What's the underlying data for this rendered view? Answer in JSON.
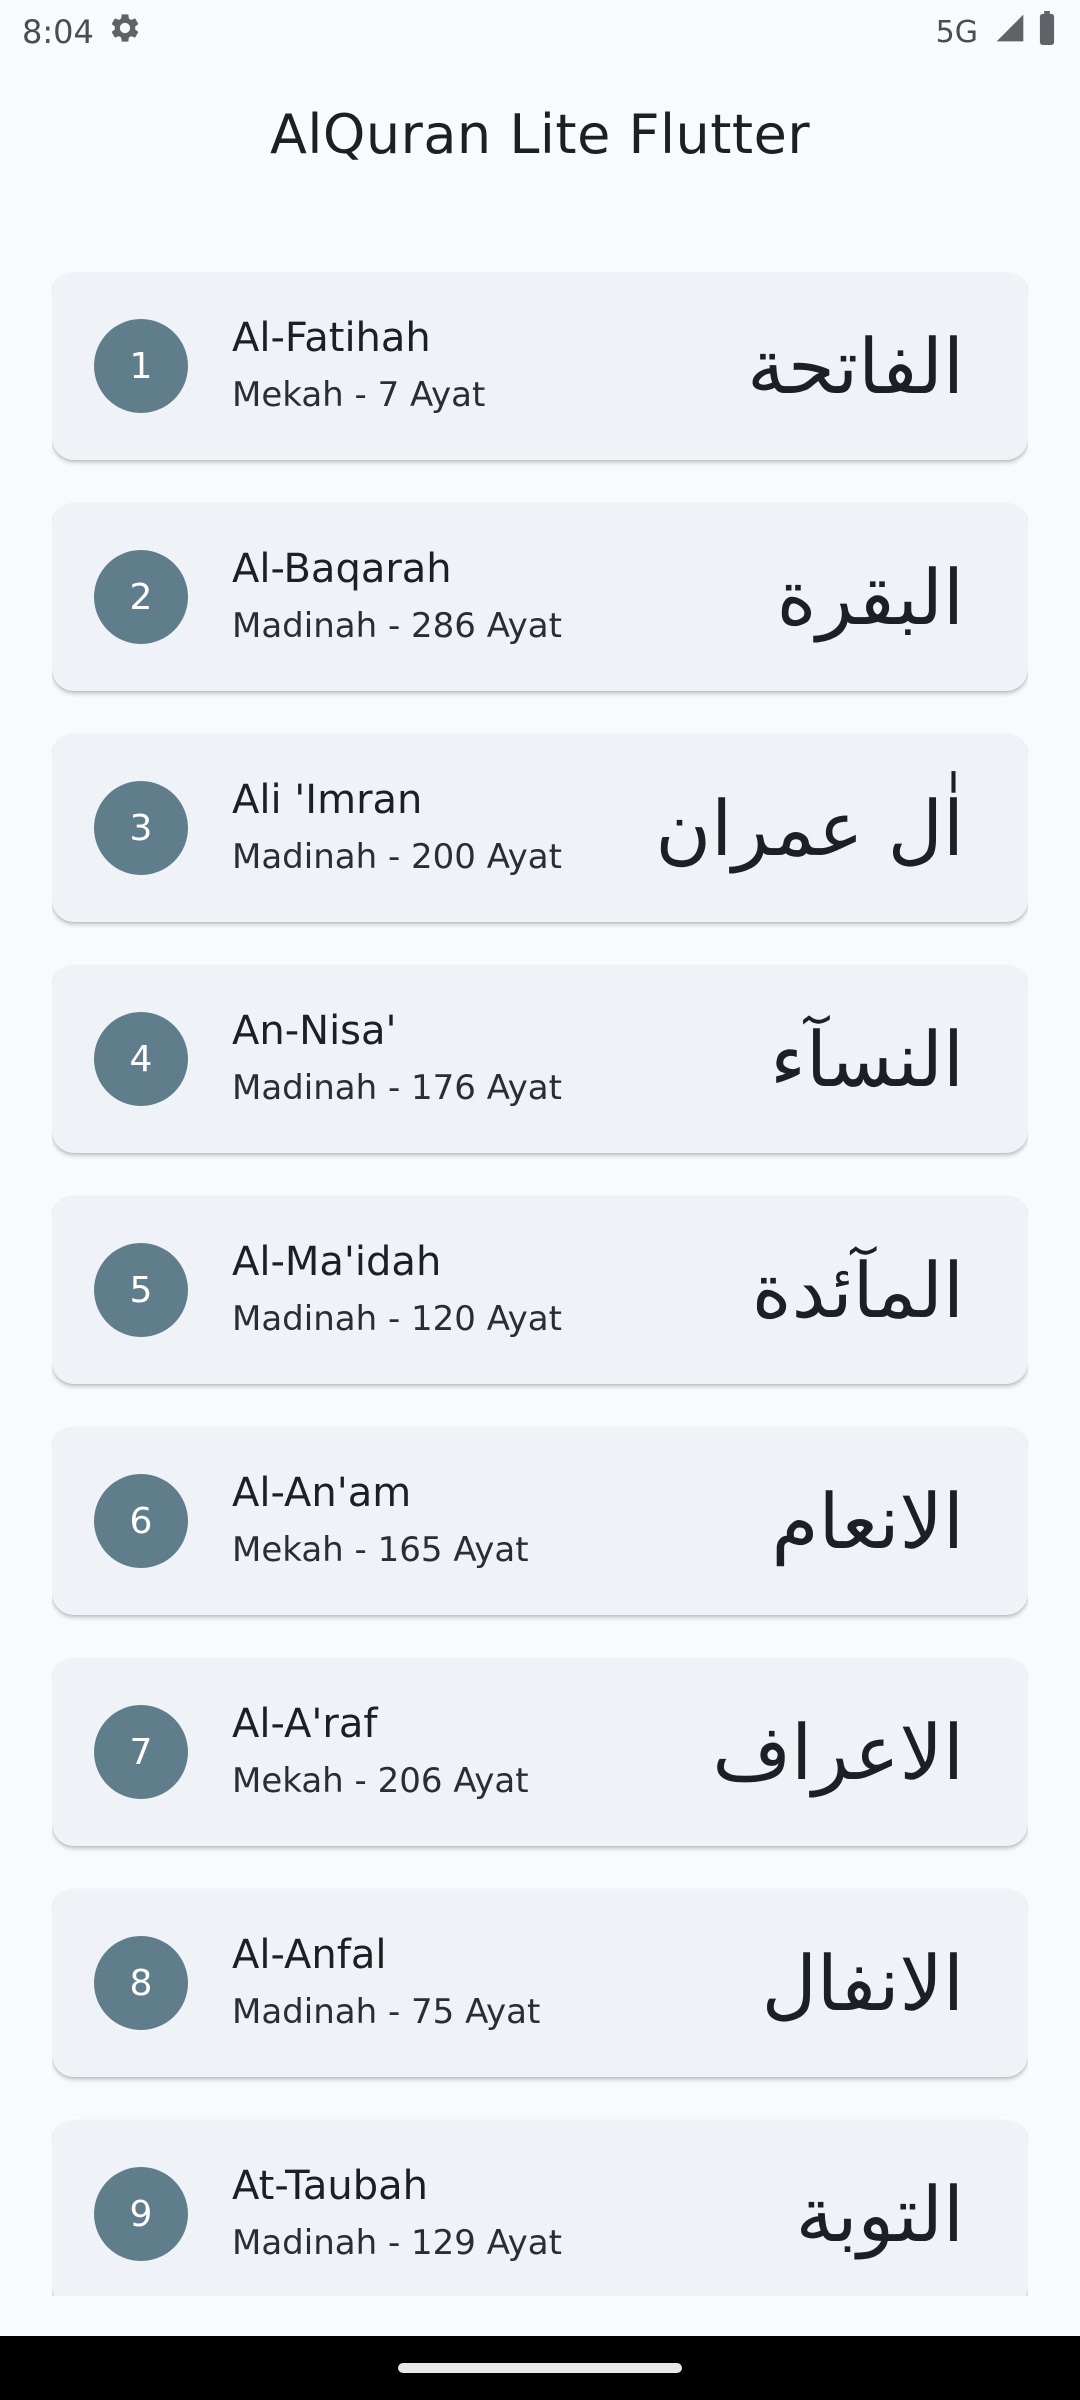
{
  "status_bar": {
    "time": "8:04",
    "network": "5G"
  },
  "app_bar": {
    "title": "AlQuran Lite Flutter"
  },
  "surahs": [
    {
      "number": "1",
      "name": "Al-Fatihah",
      "meta": "Mekah - 7 Ayat",
      "arabic": "الفاتحة"
    },
    {
      "number": "2",
      "name": "Al-Baqarah",
      "meta": "Madinah - 286 Ayat",
      "arabic": "البقرة"
    },
    {
      "number": "3",
      "name": "Ali 'Imran",
      "meta": "Madinah - 200 Ayat",
      "arabic": "اٰل عمران"
    },
    {
      "number": "4",
      "name": "An-Nisa'",
      "meta": "Madinah - 176 Ayat",
      "arabic": "النسآء"
    },
    {
      "number": "5",
      "name": "Al-Ma'idah",
      "meta": "Madinah - 120 Ayat",
      "arabic": "المآئدة"
    },
    {
      "number": "6",
      "name": "Al-An'am",
      "meta": "Mekah - 165 Ayat",
      "arabic": "الانعام"
    },
    {
      "number": "7",
      "name": "Al-A'raf",
      "meta": "Mekah - 206 Ayat",
      "arabic": "الاعراف"
    },
    {
      "number": "8",
      "name": "Al-Anfal",
      "meta": "Madinah - 75 Ayat",
      "arabic": "الانفال"
    },
    {
      "number": "9",
      "name": "At-Taubah",
      "meta": "Madinah - 129 Ayat",
      "arabic": "التوبة"
    }
  ],
  "colors": {
    "background": "#f8fafd",
    "card": "#eff3f7",
    "badge": "#607d8b",
    "badge_text": "#ffffff",
    "nav_bar": "#000000"
  }
}
